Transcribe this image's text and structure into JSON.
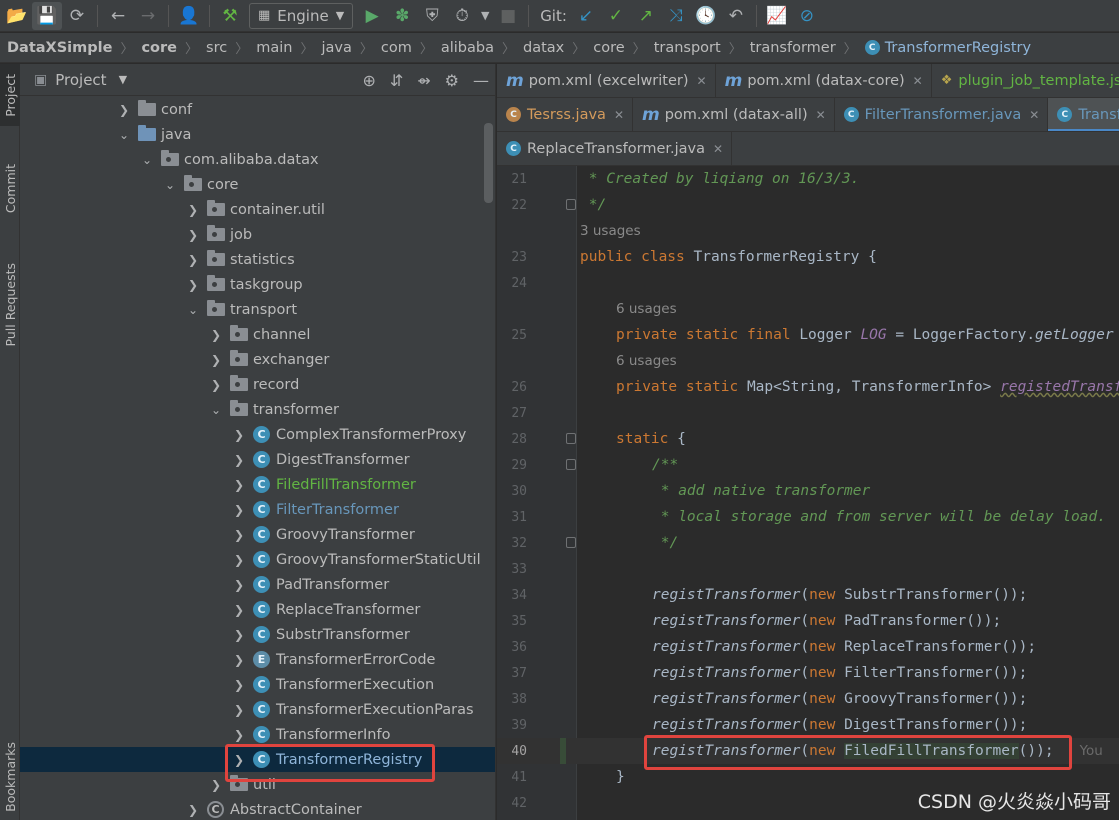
{
  "toolbar": {
    "run_config": "Engine",
    "git_label": "Git:"
  },
  "breadcrumb": [
    "DataXSimple",
    "core",
    "src",
    "main",
    "java",
    "com",
    "alibaba",
    "datax",
    "core",
    "transport",
    "transformer",
    "TransformerRegistry"
  ],
  "toolstrip": {
    "project": "Project",
    "commit": "Commit",
    "pull_requests": "Pull Requests",
    "bookmarks": "Bookmarks"
  },
  "project_panel": {
    "title": "Project",
    "tree": [
      {
        "label": "conf",
        "type": "folder"
      },
      {
        "label": "java",
        "type": "src-folder"
      },
      {
        "label": "com.alibaba.datax",
        "type": "package"
      },
      {
        "label": "core",
        "type": "package"
      },
      {
        "label": "container.util",
        "type": "package"
      },
      {
        "label": "job",
        "type": "package"
      },
      {
        "label": "statistics",
        "type": "package"
      },
      {
        "label": "taskgroup",
        "type": "package"
      },
      {
        "label": "transport",
        "type": "package"
      },
      {
        "label": "channel",
        "type": "package"
      },
      {
        "label": "exchanger",
        "type": "package"
      },
      {
        "label": "record",
        "type": "package"
      },
      {
        "label": "transformer",
        "type": "package"
      },
      {
        "label": "ComplexTransformerProxy",
        "type": "class"
      },
      {
        "label": "DigestTransformer",
        "type": "class"
      },
      {
        "label": "FiledFillTransformer",
        "type": "class",
        "status": "new"
      },
      {
        "label": "FilterTransformer",
        "type": "class",
        "status": "modified"
      },
      {
        "label": "GroovyTransformer",
        "type": "class"
      },
      {
        "label": "GroovyTransformerStaticUtil",
        "type": "class"
      },
      {
        "label": "PadTransformer",
        "type": "class"
      },
      {
        "label": "ReplaceTransformer",
        "type": "class"
      },
      {
        "label": "SubstrTransformer",
        "type": "class"
      },
      {
        "label": "TransformerErrorCode",
        "type": "enum"
      },
      {
        "label": "TransformerExecution",
        "type": "class"
      },
      {
        "label": "TransformerExecutionParas",
        "type": "class"
      },
      {
        "label": "TransformerInfo",
        "type": "class"
      },
      {
        "label": "TransformerRegistry",
        "type": "class",
        "selected": true
      },
      {
        "label": "util",
        "type": "package"
      },
      {
        "label": "AbstractContainer",
        "type": "abstract-class"
      }
    ]
  },
  "editor": {
    "tabs_row1": [
      {
        "label": "pom.xml (excelwriter)",
        "icon": "maven-icon"
      },
      {
        "label": "pom.xml (datax-core)",
        "icon": "maven-icon"
      },
      {
        "label": "plugin_job_template.json",
        "icon": "json-icon"
      }
    ],
    "tabs_row2": [
      {
        "label": "Tesrss.java",
        "icon": "class-warn-icon"
      },
      {
        "label": "pom.xml (datax-all)",
        "icon": "maven-icon"
      },
      {
        "label": "FilterTransformer.java",
        "icon": "class-icon"
      },
      {
        "label": "TransformerRegistry.java",
        "icon": "class-icon",
        "active": true
      }
    ],
    "tabs_row3": [
      {
        "label": "ReplaceTransformer.java",
        "icon": "class-icon"
      }
    ],
    "code": {
      "l21_num": "21",
      "l21": " * Created by liqiang on 16/3/3.",
      "l22_num": "22",
      "l22": " */",
      "usages1": "3 usages",
      "l23_num": "23",
      "l23_kw": "public class ",
      "l23_name": "TransformerRegistry {",
      "l24_num": "24",
      "usages2": "6 usages",
      "l25_num": "25",
      "l25_kw": "private static final ",
      "l25_type": "Logger ",
      "l25_field": "LOG",
      "l25_rest": " = LoggerFactory.",
      "l25_call": "getLogger",
      "usages3": "6 usages",
      "l26_num": "26",
      "l26_kw": "private static ",
      "l26_type": "Map<String, TransformerInfo> ",
      "l26_field": "registedTransformer",
      "l27_num": "27",
      "l28_num": "28",
      "l28_kw": "static ",
      "l28_rest": "{",
      "l29_num": "29",
      "l29": "/**",
      "l30_num": "30",
      "l30": " * add native transformer",
      "l31_num": "31",
      "l31": " * local storage and from server will be delay load.",
      "l32_num": "32",
      "l32": " */",
      "l33_num": "33",
      "l34_num": "34",
      "l34_name": "SubstrTransformer",
      "l35_num": "35",
      "l35_name": "PadTransformer",
      "l36_num": "36",
      "l36_name": "ReplaceTransformer",
      "l37_num": "37",
      "l37_name": "FilterTransformer",
      "l38_num": "38",
      "l38_name": "GroovyTransformer",
      "l39_num": "39",
      "l39_name": "DigestTransformer",
      "l40_num": "40",
      "l40_name": "FiledFillTransformer",
      "l40_hint": "You",
      "l41_num": "41",
      "l41": "}",
      "l42_num": "42",
      "call_fn": "registTransformer",
      "new_kw": "new ",
      "call_end": "());"
    }
  },
  "watermark": "CSDN @火炎焱小码哥",
  "colors": {
    "selection": "#0d293e",
    "highlight_box": "#e0443e",
    "keyword": "#cc7832",
    "comment": "#629755",
    "field": "#9876aa"
  }
}
